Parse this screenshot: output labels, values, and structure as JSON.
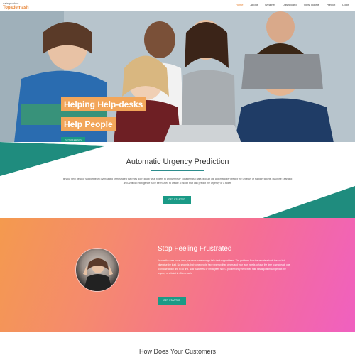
{
  "brand": {
    "small": "data product",
    "main": "Topademash"
  },
  "nav": {
    "items": [
      "Home",
      "About",
      "Weather",
      "Dashboard",
      "View Tickets",
      "Predict",
      "Login"
    ],
    "active_index": 0
  },
  "hero": {
    "line1": "Helping Help-desks",
    "line2": "Help People",
    "button": "GET STARTED"
  },
  "urgency": {
    "title": "Automatic Urgency Prediction",
    "text": "Is your help desk or support team overloaded or frustrated that they don't know what tickets to answer first? Topademash data product will automatically predict the urgency of support tickets. Machine Learning and Artificial Intelligence have been used to create a model that can predict the urgency of a ticket.",
    "button": "GET STARTED"
  },
  "frustrated": {
    "title": "Stop Feeling Frustrated",
    "text": "As was the case for us once, we never have enough help desk support team. The problems from the reporters to do the job but otherwise the lead. No seconds that some people have urgency than others and your team needs to have the time to send each one to choose which one to do first. Now customers or employees have a problem they need fixed fast, this algorithm can predict the urgency of a ticket in 400ms each.",
    "button": "GET STARTED"
  },
  "bottom": {
    "title": "How Does Your Customers"
  },
  "colors": {
    "accent": "#e8873a",
    "teal": "#1a9a86",
    "pink": "#f060c0",
    "orange": "#f49a4e"
  }
}
